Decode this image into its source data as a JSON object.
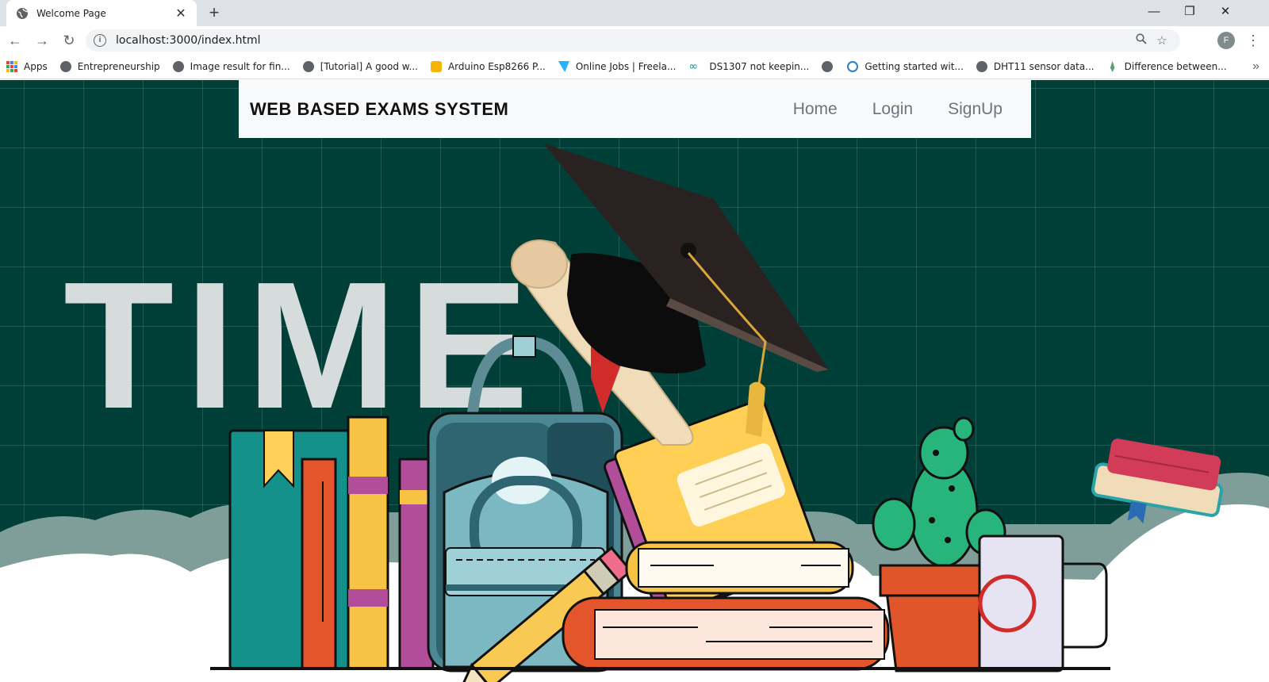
{
  "browser": {
    "tab_title": "Welcome Page",
    "tab_close": "✕",
    "new_tab": "+",
    "url": "localhost:3000/index.html",
    "avatar_letter": "F",
    "window": {
      "minimize": "—",
      "restore": "❐",
      "close": "✕"
    }
  },
  "bookmarks": {
    "apps_label": "Apps",
    "items": [
      {
        "label": "Entrepreneurship",
        "icon": "globe-icon"
      },
      {
        "label": "Image result for fin...",
        "icon": "globe-icon"
      },
      {
        "label": "[Tutorial] A good w...",
        "icon": "globe-icon"
      },
      {
        "label": "Arduino Esp8266 P...",
        "icon": "robot-icon"
      },
      {
        "label": "Online Jobs | Freela...",
        "icon": "freelancer-icon"
      },
      {
        "label": "DS1307 not keepin...",
        "icon": "arduino-icon"
      },
      {
        "label": "",
        "icon": "globe-icon"
      },
      {
        "label": "Getting started wit...",
        "icon": "raspberry-icon"
      },
      {
        "label": "DHT11 sensor data...",
        "icon": "globe-icon"
      },
      {
        "label": "Difference between...",
        "icon": "leaf-icon"
      }
    ]
  },
  "site": {
    "brand": "WEB BASED EXAMS SYSTEM",
    "nav": [
      "Home",
      "Login",
      "SignUp"
    ],
    "hero_word": "TIME"
  },
  "colors": {
    "background": "#003f38",
    "navbar": "#f8f9fa",
    "nav_link": "#6c757d",
    "hero_word": "#d5dcdb"
  }
}
